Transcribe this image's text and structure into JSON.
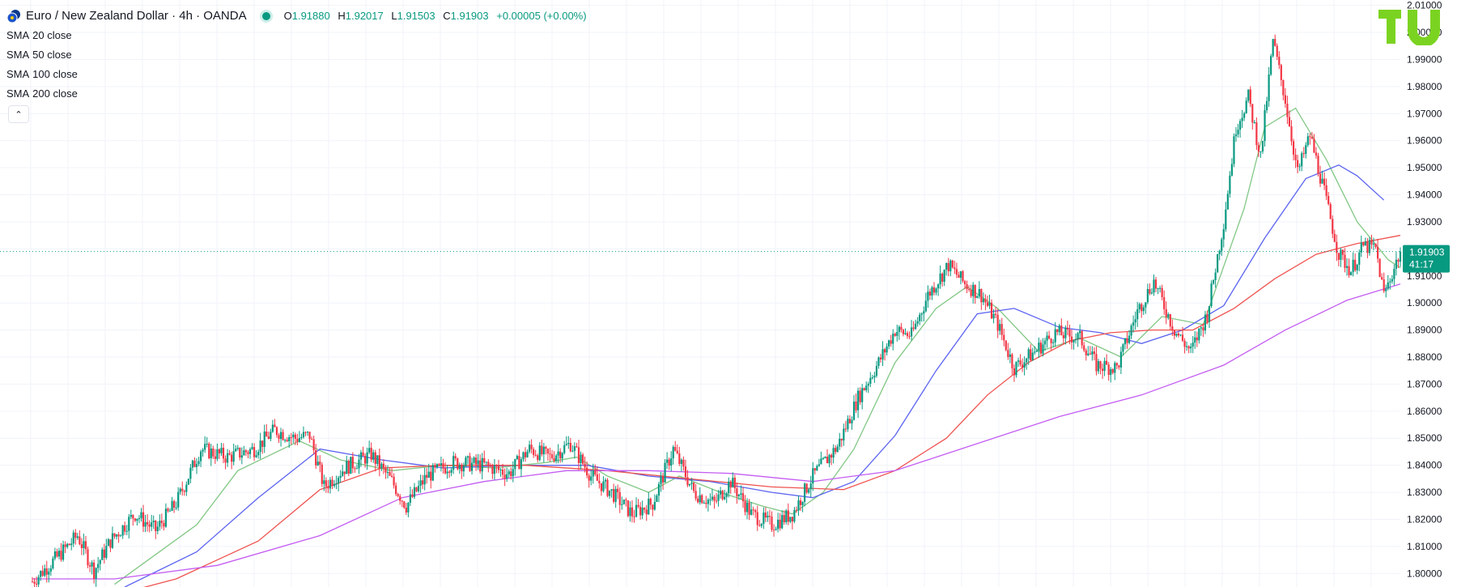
{
  "header": {
    "symbol_title": "Euro / New Zealand Dollar · 4h · OANDA",
    "ohlc": [
      {
        "k": "O",
        "v": "1.91880"
      },
      {
        "k": "H",
        "v": "1.92017"
      },
      {
        "k": "L",
        "v": "1.91503"
      },
      {
        "k": "C",
        "v": "1.91903"
      }
    ],
    "change": "+0.00005 (+0.00%)"
  },
  "indicators": [
    {
      "s": "SMA",
      "label": "20 close",
      "color": "#81c784"
    },
    {
      "s": "SMA",
      "label": "50 close",
      "color": "#5b63f0"
    },
    {
      "s": "SMA",
      "label": "100 close",
      "color": "#ef5350"
    },
    {
      "s": "SMA",
      "label": "200 close",
      "color": "#c45cf2"
    }
  ],
  "collapse_glyph": "⌃",
  "price_badge": {
    "price": "1.91903",
    "countdown": "41:17",
    "color": "#089981"
  },
  "colors": {
    "up": "#089981",
    "down": "#f23645",
    "grid": "#f0f3fa",
    "axis_text": "#131722",
    "logo": "#7bd321"
  },
  "chart_data": {
    "type": "candlestick",
    "ylim": [
      1.795,
      2.012
    ],
    "y_ticks": [
      "1.80000",
      "1.81000",
      "1.82000",
      "1.83000",
      "1.84000",
      "1.85000",
      "1.86000",
      "1.87000",
      "1.88000",
      "1.89000",
      "1.90000",
      "1.91000",
      "1.92000",
      "1.93000",
      "1.94000",
      "1.95000",
      "1.96000",
      "1.97000",
      "1.98000",
      "1.99000",
      "2.00000",
      "2.01000"
    ],
    "last_price": 1.91903,
    "close_path": [
      [
        0,
        1.797
      ],
      [
        12,
        1.806
      ],
      [
        22,
        1.814
      ],
      [
        30,
        1.801
      ],
      [
        38,
        1.812
      ],
      [
        50,
        1.822
      ],
      [
        60,
        1.816
      ],
      [
        70,
        1.826
      ],
      [
        82,
        1.846
      ],
      [
        95,
        1.843
      ],
      [
        108,
        1.846
      ],
      [
        118,
        1.853
      ],
      [
        128,
        1.85
      ],
      [
        135,
        1.851
      ],
      [
        142,
        1.832
      ],
      [
        152,
        1.839
      ],
      [
        165,
        1.844
      ],
      [
        175,
        1.834
      ],
      [
        182,
        1.825
      ],
      [
        192,
        1.836
      ],
      [
        205,
        1.841
      ],
      [
        220,
        1.84
      ],
      [
        232,
        1.837
      ],
      [
        242,
        1.846
      ],
      [
        252,
        1.843
      ],
      [
        262,
        1.848
      ],
      [
        272,
        1.836
      ],
      [
        282,
        1.83
      ],
      [
        292,
        1.822
      ],
      [
        302,
        1.826
      ],
      [
        312,
        1.846
      ],
      [
        322,
        1.83
      ],
      [
        332,
        1.826
      ],
      [
        340,
        1.834
      ],
      [
        350,
        1.822
      ],
      [
        360,
        1.818
      ],
      [
        370,
        1.822
      ],
      [
        380,
        1.836
      ],
      [
        392,
        1.847
      ],
      [
        402,
        1.865
      ],
      [
        412,
        1.878
      ],
      [
        420,
        1.89
      ],
      [
        428,
        1.888
      ],
      [
        436,
        1.903
      ],
      [
        446,
        1.914
      ],
      [
        454,
        1.907
      ],
      [
        462,
        1.903
      ],
      [
        470,
        1.892
      ],
      [
        478,
        1.876
      ],
      [
        488,
        1.882
      ],
      [
        498,
        1.889
      ],
      [
        510,
        1.887
      ],
      [
        518,
        1.877
      ],
      [
        528,
        1.876
      ],
      [
        538,
        1.897
      ],
      [
        546,
        1.908
      ],
      [
        556,
        1.89
      ],
      [
        564,
        1.882
      ],
      [
        572,
        1.896
      ],
      [
        580,
        1.93
      ],
      [
        586,
        1.965
      ],
      [
        592,
        1.976
      ],
      [
        598,
        1.954
      ],
      [
        604,
        1.997
      ],
      [
        610,
        1.975
      ],
      [
        616,
        1.948
      ],
      [
        622,
        1.962
      ],
      [
        628,
        1.944
      ],
      [
        636,
        1.918
      ],
      [
        642,
        1.912
      ],
      [
        648,
        1.921
      ],
      [
        654,
        1.92
      ],
      [
        658,
        1.903
      ],
      [
        666,
        1.919
      ]
    ],
    "series": [
      {
        "name": "SMA 20 close",
        "color": "#81c784",
        "values": [
          [
            40,
            1.796
          ],
          [
            80,
            1.818
          ],
          [
            100,
            1.838
          ],
          [
            130,
            1.849
          ],
          [
            150,
            1.842
          ],
          [
            175,
            1.838
          ],
          [
            200,
            1.84
          ],
          [
            225,
            1.839
          ],
          [
            250,
            1.841
          ],
          [
            265,
            1.843
          ],
          [
            280,
            1.836
          ],
          [
            300,
            1.83
          ],
          [
            315,
            1.836
          ],
          [
            335,
            1.83
          ],
          [
            355,
            1.825
          ],
          [
            370,
            1.822
          ],
          [
            385,
            1.83
          ],
          [
            400,
            1.846
          ],
          [
            420,
            1.878
          ],
          [
            440,
            1.898
          ],
          [
            455,
            1.906
          ],
          [
            470,
            1.898
          ],
          [
            490,
            1.882
          ],
          [
            510,
            1.887
          ],
          [
            530,
            1.88
          ],
          [
            550,
            1.895
          ],
          [
            570,
            1.892
          ],
          [
            590,
            1.935
          ],
          [
            600,
            1.965
          ],
          [
            615,
            1.972
          ],
          [
            630,
            1.953
          ],
          [
            645,
            1.93
          ],
          [
            660,
            1.916
          ],
          [
            666,
            1.913
          ]
        ]
      },
      {
        "name": "SMA 50 close",
        "color": "#5b63f0",
        "values": [
          [
            45,
            1.795
          ],
          [
            80,
            1.808
          ],
          [
            110,
            1.828
          ],
          [
            140,
            1.846
          ],
          [
            170,
            1.842
          ],
          [
            200,
            1.839
          ],
          [
            235,
            1.84
          ],
          [
            270,
            1.84
          ],
          [
            300,
            1.836
          ],
          [
            330,
            1.834
          ],
          [
            360,
            1.83
          ],
          [
            380,
            1.828
          ],
          [
            400,
            1.834
          ],
          [
            420,
            1.851
          ],
          [
            440,
            1.875
          ],
          [
            460,
            1.896
          ],
          [
            478,
            1.898
          ],
          [
            500,
            1.891
          ],
          [
            520,
            1.889
          ],
          [
            540,
            1.885
          ],
          [
            560,
            1.89
          ],
          [
            580,
            1.899
          ],
          [
            600,
            1.924
          ],
          [
            620,
            1.946
          ],
          [
            636,
            1.951
          ],
          [
            645,
            1.947
          ],
          [
            658,
            1.938
          ]
        ]
      },
      {
        "name": "SMA 100 close",
        "color": "#ef5350",
        "values": [
          [
            40,
            1.792
          ],
          [
            70,
            1.798
          ],
          [
            110,
            1.812
          ],
          [
            140,
            1.831
          ],
          [
            170,
            1.839
          ],
          [
            200,
            1.84
          ],
          [
            240,
            1.84
          ],
          [
            280,
            1.838
          ],
          [
            320,
            1.835
          ],
          [
            360,
            1.832
          ],
          [
            395,
            1.831
          ],
          [
            420,
            1.838
          ],
          [
            445,
            1.85
          ],
          [
            465,
            1.866
          ],
          [
            485,
            1.878
          ],
          [
            505,
            1.886
          ],
          [
            525,
            1.889
          ],
          [
            545,
            1.89
          ],
          [
            565,
            1.89
          ],
          [
            585,
            1.898
          ],
          [
            605,
            1.909
          ],
          [
            625,
            1.918
          ],
          [
            645,
            1.922
          ],
          [
            666,
            1.925
          ]
        ]
      },
      {
        "name": "SMA 200 close",
        "color": "#c45cf2",
        "values": [
          [
            0,
            1.798
          ],
          [
            40,
            1.798
          ],
          [
            90,
            1.803
          ],
          [
            140,
            1.814
          ],
          [
            180,
            1.828
          ],
          [
            220,
            1.834
          ],
          [
            260,
            1.838
          ],
          [
            300,
            1.838
          ],
          [
            340,
            1.837
          ],
          [
            380,
            1.834
          ],
          [
            420,
            1.838
          ],
          [
            460,
            1.848
          ],
          [
            500,
            1.858
          ],
          [
            540,
            1.866
          ],
          [
            580,
            1.877
          ],
          [
            610,
            1.89
          ],
          [
            640,
            1.901
          ],
          [
            666,
            1.907
          ]
        ]
      }
    ]
  }
}
